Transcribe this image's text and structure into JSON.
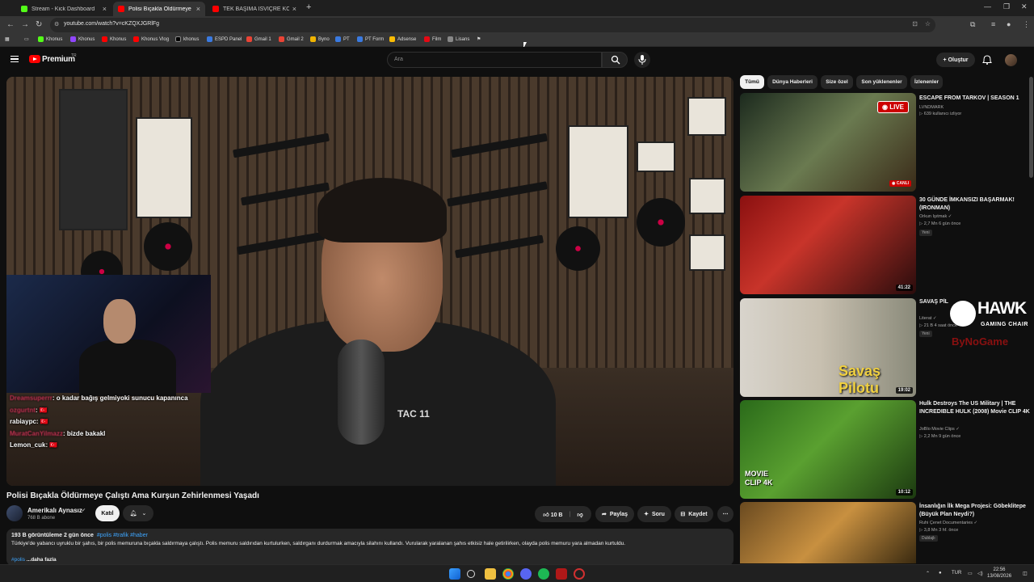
{
  "browser": {
    "tabs": [
      {
        "label": "Stream - Kick Dashboard",
        "color": "#53fc18"
      },
      {
        "label": "Polisi Bıçakla Öldürmeye Çalıştı",
        "color": "#ff0000"
      },
      {
        "label": "TEK BAŞIMA İSVİÇRE KÖYLERİN",
        "color": "#ff0000"
      }
    ],
    "url": "youtube.com/watch?v=cKZQXJGRlFg",
    "bookmarks": [
      "Khonus",
      "Khonus",
      "Khonus",
      "Khonus Vlog",
      "khonus",
      "ESPD Panel",
      "Gmail 1",
      "Gmail 2",
      "Byno",
      "PT",
      "PT Form",
      "Adsense",
      "Film",
      "Lisans"
    ]
  },
  "masthead": {
    "logo_text": "Premium",
    "region": "TR",
    "search_placeholder": "Ara",
    "create_label": "Oluştur"
  },
  "video": {
    "overlay_text": "TAC 11",
    "chat": [
      {
        "user": "Dreamsuperrr",
        "message": ": o kadar bağış gelmiyoki sunucu kapanınca",
        "blur": true
      },
      {
        "user": "ozgurtnt",
        "message": ": 🇹🇷",
        "blur": true
      },
      {
        "user": "rabiaypc",
        "message": ": 🇹🇷",
        "blur": false
      },
      {
        "user": "MuratCanYilmazz",
        "message": ": bizde bakakl",
        "blur": true
      },
      {
        "user": "Lemon_cuk",
        "message": ": 🇹🇷",
        "blur": false
      }
    ],
    "title": "Polisi Bıçakla Öldürmeye Çalıştı Ama Kurşun Zehirlenmesi Yaşadı",
    "channel": "Amerikalı Aynasız",
    "subscribers": "768 B abone",
    "join_label": "Katıl",
    "likes": "10 B",
    "share_label": "Paylaş",
    "ask_label": "Soru",
    "save_label": "Kaydet",
    "stats": "193 B görüntüleme  2 gün önce",
    "tags": "#polis #trafik #haber",
    "description": "Türkiye'de yabancı uyruklu bir şahıs, bir polis memuruna bıçakla saldırmaya çalıştı. Polis memuru saldırıdan kurtulurken, saldırganı durdurmak amacıyla silahını kullandı. Vurularak yaralanan şahıs etkisiz hale getirilirken, olayda polis memuru yara almadan kurtuldu.",
    "more_label": "...daha fazla",
    "more_prefix": "#polis"
  },
  "chips": [
    "Tümü",
    "Dünya Haberleri",
    "Size özel",
    "Son yüklenenler",
    "İzlenenler"
  ],
  "related": [
    {
      "title": "ESCAPE FROM TARKOV | SEASON 1",
      "channel": "LVNDMARK",
      "meta": "▷ 639 kullanıcı izliyor",
      "badge": "",
      "duration": "",
      "live": "LIVE",
      "canli": "CANLI"
    },
    {
      "title": "30 GÜNDE İMKANSIZI BAŞARMAK! (IRONMAN)",
      "channel": "Orkun Işıtmak ✓",
      "meta": "▷ 2,7 Mn  6 gün önce",
      "badge": "Yeni",
      "duration": "41:22"
    },
    {
      "title": "SAVAŞ PİLOTU: GERÇEK SAVAŞ UÇAĞI VİDEOLARI",
      "channel": "Literat ✓",
      "meta": "▷ 21 B  4 saat önce",
      "badge": "Yeni",
      "duration": "19:02",
      "thumb_text": "Savaş Pilotu"
    },
    {
      "title": "Hulk Destroys The US Military | THE INCREDIBLE HULK (2008) Movie CLIP 4K",
      "channel": "JoBlo Movie Clips ✓",
      "meta": "▷ 2,2 Mn  9 gün önce",
      "badge": "",
      "duration": "10:12",
      "thumb_text": "MOVIE CLIP 4K"
    },
    {
      "title": "İnsanlığın İlk Mega Projesi: Göbeklitepe (Büyük Plan Neydi?)",
      "channel": "Ruhi Çenet Documentaries ✓",
      "meta": "▷ 3,8 Mn  3 hf. önce",
      "badge": "Dublajlı",
      "duration": ""
    }
  ],
  "overlay_logo": {
    "word": "HAWK",
    "sub": "GAMING CHAIR",
    "partner": "ByNoGame"
  },
  "taskbar": {
    "lang": "TUR",
    "time": "22:56",
    "date": "13/08/2026"
  },
  "colors": {
    "accent": "#ff0000",
    "link": "#3ea6ff",
    "bg": "#0f0f0f",
    "surface": "#272727"
  }
}
